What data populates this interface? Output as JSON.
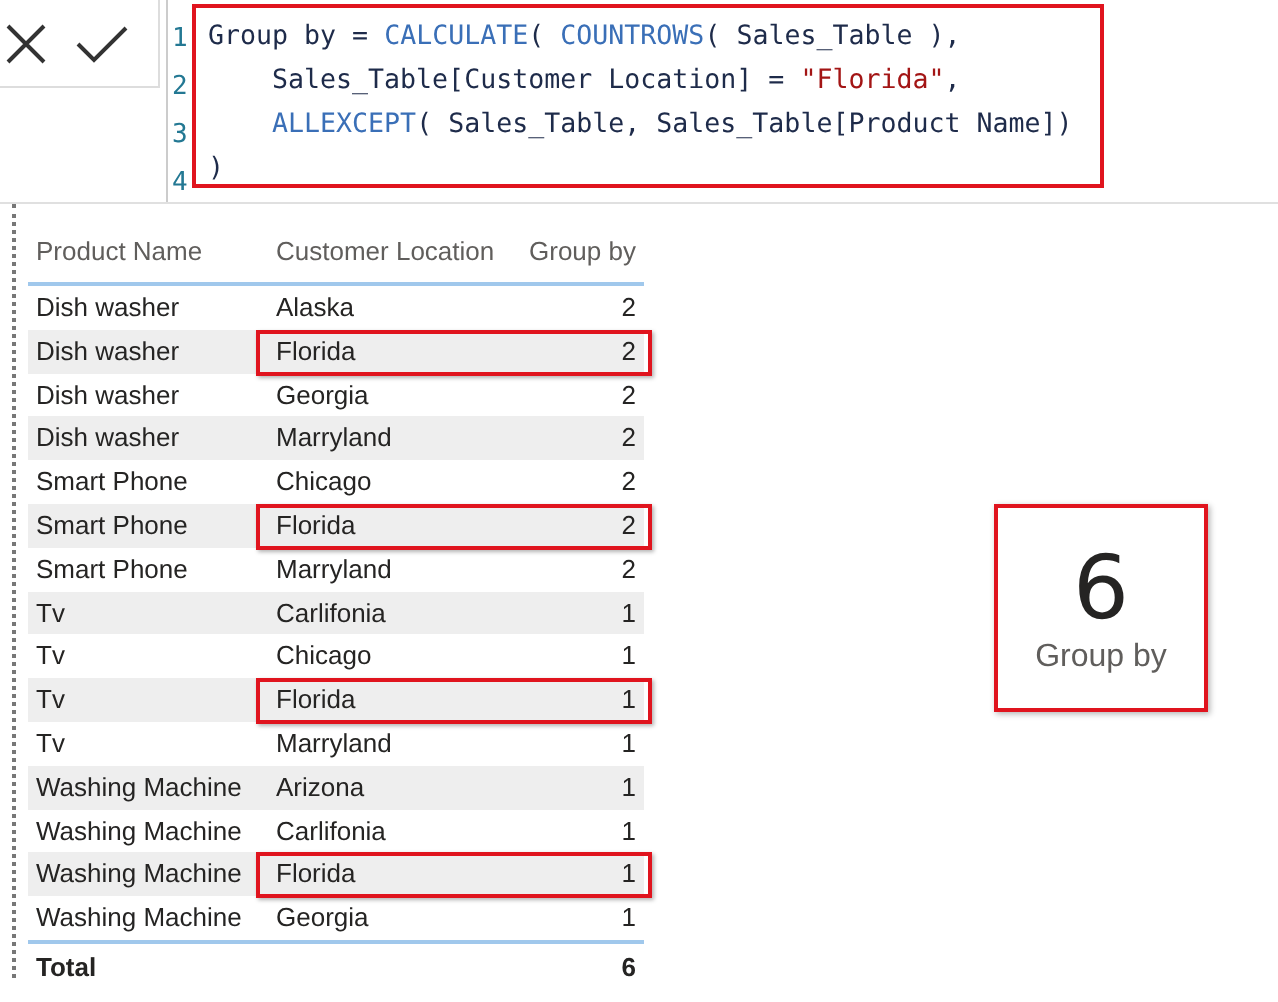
{
  "formula_bar": {
    "lines": [
      {
        "number": "1",
        "indented": false,
        "tokens": [
          {
            "kind": "plain",
            "text": "Group by = "
          },
          {
            "kind": "function",
            "text": "CALCULATE"
          },
          {
            "kind": "plain",
            "text": "( "
          },
          {
            "kind": "function",
            "text": "COUNTROWS"
          },
          {
            "kind": "plain",
            "text": "( Sales_Table ),"
          }
        ]
      },
      {
        "number": "2",
        "indented": true,
        "tokens": [
          {
            "kind": "plain",
            "text": "Sales_Table[Customer Location] = "
          },
          {
            "kind": "string",
            "text": "\"Florida\""
          },
          {
            "kind": "plain",
            "text": ","
          }
        ]
      },
      {
        "number": "3",
        "indented": true,
        "tokens": [
          {
            "kind": "function",
            "text": "ALLEXCEPT"
          },
          {
            "kind": "plain",
            "text": "( Sales_Table, Sales_Table[Product Name])"
          }
        ]
      },
      {
        "number": "4",
        "indented": false,
        "tokens": [
          {
            "kind": "plain",
            "text": ")"
          }
        ]
      }
    ]
  },
  "table": {
    "columns": [
      "Product Name",
      "Customer Location",
      "Group by"
    ],
    "rows": [
      {
        "cells": [
          "Dish washer",
          "Alaska",
          "2"
        ],
        "highlighted": false
      },
      {
        "cells": [
          "Dish washer",
          "Florida",
          "2"
        ],
        "highlighted": true
      },
      {
        "cells": [
          "Dish washer",
          "Georgia",
          "2"
        ],
        "highlighted": false
      },
      {
        "cells": [
          "Dish washer",
          "Marryland",
          "2"
        ],
        "highlighted": false
      },
      {
        "cells": [
          "Smart Phone",
          "Chicago",
          "2"
        ],
        "highlighted": false
      },
      {
        "cells": [
          "Smart Phone",
          "Florida",
          "2"
        ],
        "highlighted": true
      },
      {
        "cells": [
          "Smart Phone",
          "Marryland",
          "2"
        ],
        "highlighted": false
      },
      {
        "cells": [
          "Tv",
          "Carlifonia",
          "1"
        ],
        "highlighted": false
      },
      {
        "cells": [
          "Tv",
          "Chicago",
          "1"
        ],
        "highlighted": false
      },
      {
        "cells": [
          "Tv",
          "Florida",
          "1"
        ],
        "highlighted": true
      },
      {
        "cells": [
          "Tv",
          "Marryland",
          "1"
        ],
        "highlighted": false
      },
      {
        "cells": [
          "Washing Machine",
          "Arizona",
          "1"
        ],
        "highlighted": false
      },
      {
        "cells": [
          "Washing Machine",
          "Carlifonia",
          "1"
        ],
        "highlighted": false
      },
      {
        "cells": [
          "Washing Machine",
          "Florida",
          "1"
        ],
        "highlighted": true
      },
      {
        "cells": [
          "Washing Machine",
          "Georgia",
          "1"
        ],
        "highlighted": false
      }
    ],
    "total": {
      "label": "Total",
      "value": "6"
    }
  },
  "card": {
    "value": "6",
    "label": "Group by"
  }
}
